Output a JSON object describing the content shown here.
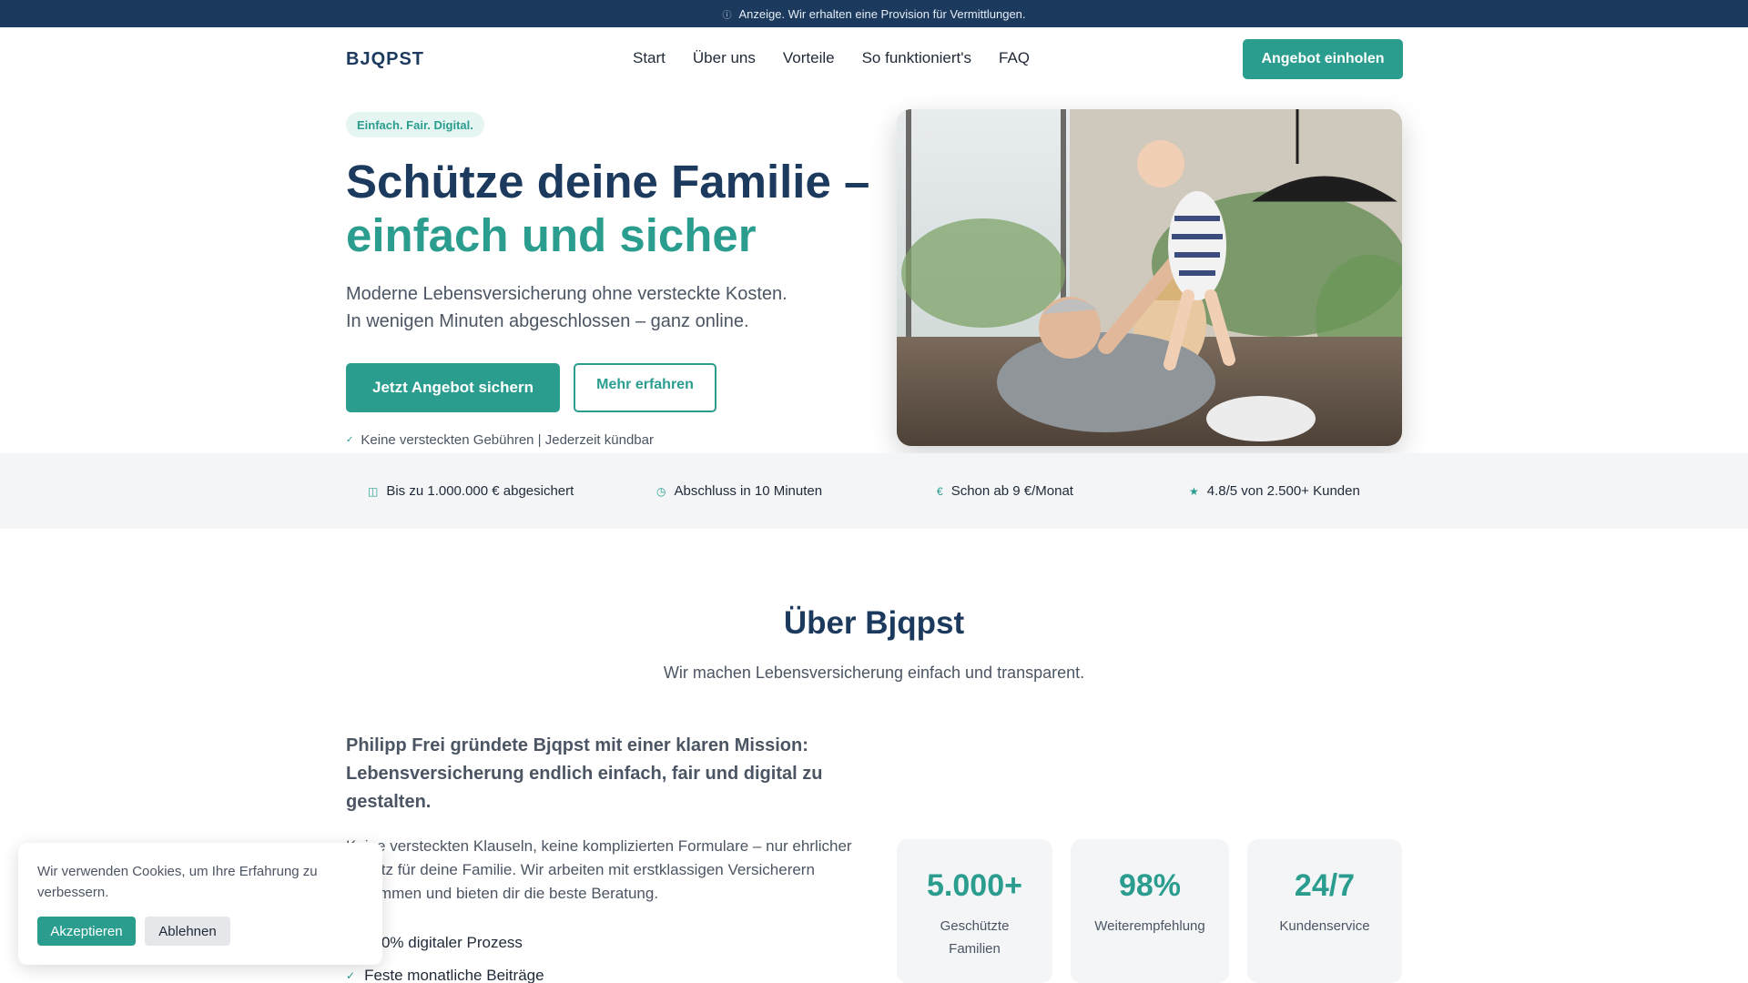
{
  "topbar": {
    "icon": "info-icon",
    "text": "Anzeige. Wir erhalten eine Provision für Vermittlungen."
  },
  "nav": {
    "logo": "BJQPST",
    "items": [
      "Start",
      "Über uns",
      "Vorteile",
      "So funktioniert's",
      "FAQ"
    ],
    "cta": "Angebot einholen"
  },
  "hero": {
    "badge": "Einfach. Fair. Digital.",
    "title_line1": "Schütze deine Familie –",
    "title_line2": "einfach und sicher",
    "lead_line1": "Moderne Lebensversicherung ohne versteckte Kosten.",
    "lead_line2": "In wenigen Minuten abgeschlossen – ganz online.",
    "primary_button": "Jetzt Angebot sichern",
    "secondary_button": "Mehr erfahren",
    "note": "Keine versteckten Gebühren | Jederzeit kündbar",
    "image_alt": "Familie mit Baby auf dem Sofa"
  },
  "features": [
    {
      "icon": "shield-icon",
      "text": "Bis zu 1.000.000 € abgesichert"
    },
    {
      "icon": "clock-icon",
      "text": "Abschluss in 10 Minuten"
    },
    {
      "icon": "euro-icon",
      "text": "Schon ab 9 €/Monat"
    },
    {
      "icon": "star-icon",
      "text": "4.8/5 von 2.500+ Kunden"
    }
  ],
  "about": {
    "title": "Über Bjqpst",
    "subtitle": "Wir machen Lebensversicherung einfach und transparent.",
    "mission": "Philipp Frei gründete Bjqpst mit einer klaren Mission: Lebensversicherung endlich einfach, fair und digital zu gestalten.",
    "body": "Keine versteckten Klauseln, keine komplizierten Formulare – nur ehrlicher Schutz für deine Familie. Wir arbeiten mit erstklassigen Versicherern zusammen und bieten dir die beste Beratung.",
    "checks": [
      "100% digitaler Prozess",
      "Feste monatliche Beiträge"
    ],
    "stats": [
      {
        "value": "5.000+",
        "label": "Geschützte Familien"
      },
      {
        "value": "98%",
        "label": "Weiterempfehlung"
      },
      {
        "value": "24/7",
        "label": "Kundenservice"
      }
    ]
  },
  "cookie": {
    "text": "Wir verwenden Cookies, um Ihre Erfahrung zu verbessern.",
    "accept": "Akzeptieren",
    "decline": "Ablehnen"
  },
  "colors": {
    "navy": "#1c3a5e",
    "accent": "#2a9d8f",
    "light_bg": "#f3f5f7"
  }
}
